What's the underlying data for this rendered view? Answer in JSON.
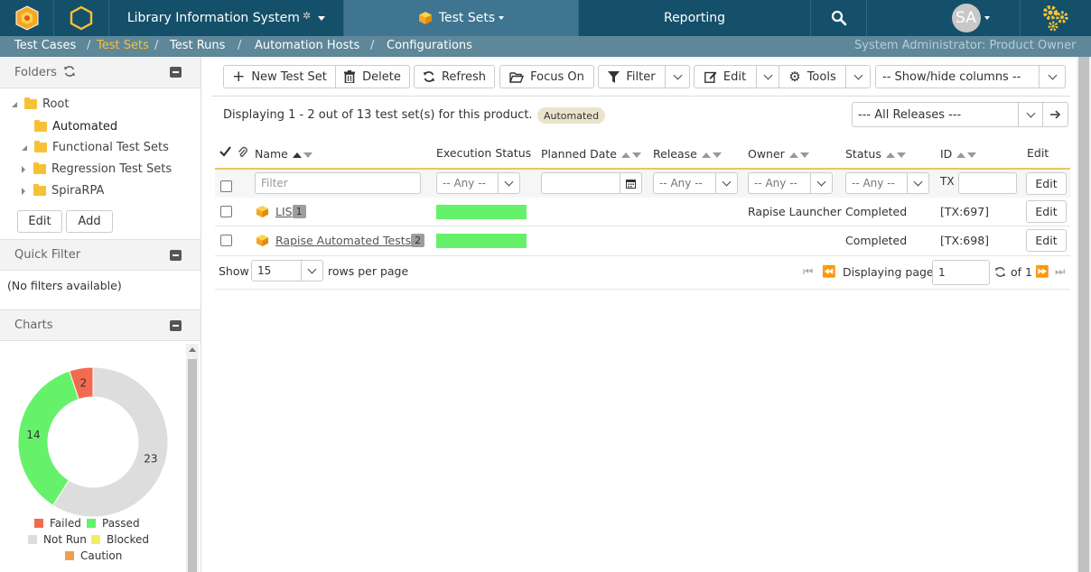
{
  "topbar": {
    "product": "Library Information System",
    "workspace": "Test Sets",
    "reporting": "Reporting",
    "avatar_initials": "SA"
  },
  "subnav": {
    "items": [
      "Test Cases",
      "Test Sets",
      "Test Runs",
      "Automation Hosts",
      "Configurations"
    ],
    "user_role": "System Administrator: Product Owner"
  },
  "folders": {
    "title": "Folders",
    "items": [
      {
        "label": "Root"
      },
      {
        "label": "Automated"
      },
      {
        "label": "Functional Test Sets"
      },
      {
        "label": "Regression Test Sets"
      },
      {
        "label": "SpiraRPA"
      }
    ],
    "edit_label": "Edit",
    "add_label": "Add"
  },
  "quick_filter": {
    "title": "Quick Filter",
    "empty_text": "(No filters available)"
  },
  "charts": {
    "title": "Charts",
    "legend": [
      {
        "label": "Failed",
        "color": "#f26b50"
      },
      {
        "label": "Passed",
        "color": "#66f16b"
      },
      {
        "label": "Not Run",
        "color": "#dddddd"
      },
      {
        "label": "Blocked",
        "color": "#eeef66"
      },
      {
        "label": "Caution",
        "color": "#f29e4c"
      }
    ]
  },
  "chart_data": {
    "type": "pie",
    "categories": [
      "Failed",
      "Passed",
      "Not Run",
      "Blocked",
      "Caution"
    ],
    "values": [
      2,
      14,
      23,
      0,
      0
    ],
    "colors": [
      "#f26b50",
      "#66f16b",
      "#dddddd",
      "#eeef66",
      "#f29e4c"
    ],
    "donut": true,
    "legend_position": "bottom"
  },
  "toolbar": {
    "new_label": "New Test Set",
    "delete_label": "Delete",
    "refresh_label": "Refresh",
    "focus_label": "Focus On",
    "filter_label": "Filter",
    "edit_label": "Edit",
    "tools_label": "Tools",
    "columns_label": "-- Show/hide columns --"
  },
  "summary": {
    "text": "Displaying 1 - 2 out of 13 test set(s) for this product.",
    "filter_badge": "Automated",
    "release_select": "--- All Releases ---"
  },
  "grid": {
    "columns": [
      "Name",
      "Execution Status",
      "Planned Date",
      "Release",
      "Owner",
      "Status",
      "ID",
      "Edit"
    ],
    "filters": {
      "name_placeholder": "Filter",
      "any": "-- Any --",
      "id_prefix": "TX"
    },
    "rows": [
      {
        "name": "LIS",
        "count": "1",
        "execution_passed": 1.0,
        "owner": "Rapise Launcher",
        "status": "Completed",
        "id": "[TX:697]",
        "edit": "Edit"
      },
      {
        "name": "Rapise Automated Tests",
        "count": "2",
        "execution_passed": 1.0,
        "owner": "",
        "status": "Completed",
        "id": "[TX:698]",
        "edit": "Edit"
      }
    ],
    "filter_edit": "Edit"
  },
  "pagination": {
    "show_label": "Show",
    "per_page": "15",
    "rows_per_page_label": "rows per page",
    "displaying_page_label": "Displaying page",
    "page": "1",
    "of_label": "of 1"
  }
}
